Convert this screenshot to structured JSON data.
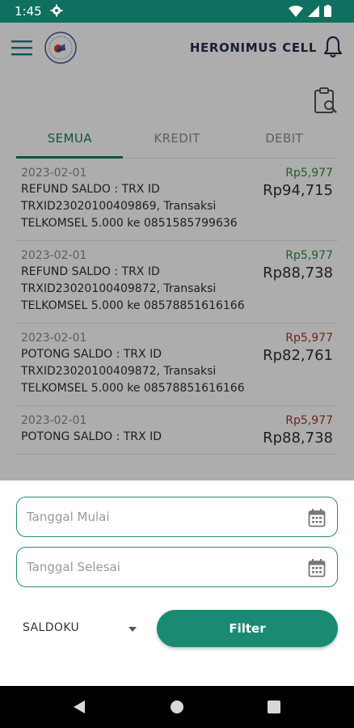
{
  "status_bar": {
    "time": "1:45",
    "icons": [
      "gear-icon",
      "wifi-icon",
      "signal-icon",
      "battery-icon"
    ]
  },
  "app_bar": {
    "title": "HERONIMUS CELL",
    "icons": [
      "menu-icon",
      "logo",
      "bell-icon"
    ]
  },
  "tabs": [
    {
      "label": "SEMUA",
      "active": true
    },
    {
      "label": "KREDIT",
      "active": false
    },
    {
      "label": "DEBIT",
      "active": false
    }
  ],
  "transactions": [
    {
      "date": "2023-02-01",
      "description": "REFUND SALDO : TRX ID TRXID23020100409869, Transaksi TELKOMSEL 5.000 ke 0851585799636",
      "amount": "Rp5,977",
      "type": "credit",
      "balance": "Rp94,715"
    },
    {
      "date": "2023-02-01",
      "description": "REFUND SALDO : TRX ID TRXID23020100409872, Transaksi TELKOMSEL 5.000 ke 08578851616166",
      "amount": "Rp5,977",
      "type": "credit",
      "balance": "Rp88,738"
    },
    {
      "date": "2023-02-01",
      "description": "POTONG SALDO : TRX ID TRXID23020100409872, Transaksi TELKOMSEL 5.000 ke 08578851616166",
      "amount": "Rp5,977",
      "type": "debit",
      "balance": "Rp82,761"
    },
    {
      "date": "2023-02-01",
      "description": "POTONG SALDO : TRX ID",
      "amount": "Rp5,977",
      "type": "debit",
      "balance": "Rp88,738"
    }
  ],
  "filter_sheet": {
    "start_date_placeholder": "Tanggal Mulai",
    "end_date_placeholder": "Tanggal Selesai",
    "wallet_selected": "SALDOKU",
    "filter_button": "Filter"
  },
  "colors": {
    "primary": "#1a8a73",
    "status_bar": "#10705f",
    "credit": "#2e8b3f",
    "debit": "#b03030"
  }
}
